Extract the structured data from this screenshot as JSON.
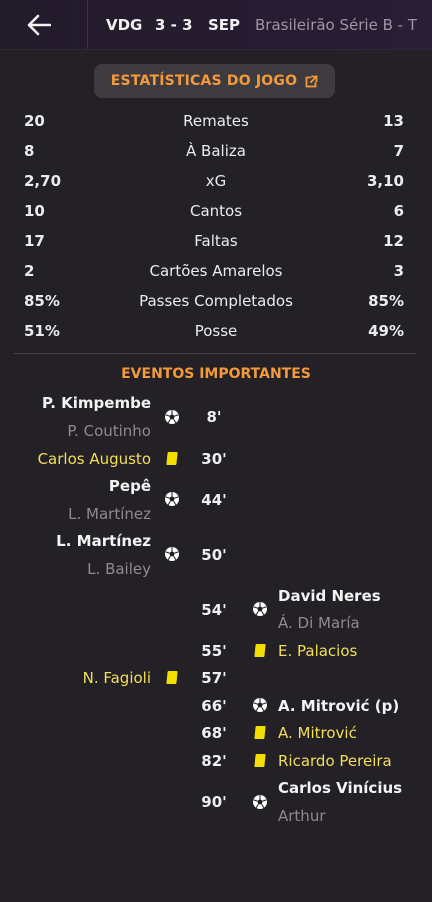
{
  "header": {
    "home_team": "VDG",
    "score": "3 - 3",
    "away_team": "SEP",
    "competition": "Brasileirão Série B  -  T"
  },
  "stats_title": "ESTATÍSTICAS DO JOGO",
  "stats": [
    {
      "name": "Remates",
      "home": "20",
      "away": "13"
    },
    {
      "name": "À Baliza",
      "home": "8",
      "away": "7"
    },
    {
      "name": "xG",
      "home": "2,70",
      "away": "3,10"
    },
    {
      "name": "Cantos",
      "home": "10",
      "away": "6"
    },
    {
      "name": "Faltas",
      "home": "17",
      "away": "12"
    },
    {
      "name": "Cartões Amarelos",
      "home": "2",
      "away": "3"
    },
    {
      "name": "Passes Completados",
      "home": "85%",
      "away": "85%"
    },
    {
      "name": "Posse",
      "home": "51%",
      "away": "49%"
    }
  ],
  "events_title": "EVENTOS IMPORTANTES",
  "events": [
    {
      "minute": "8'",
      "side": "home",
      "type": "goal",
      "player": "P. Kimpembe",
      "assist": "P. Coutinho"
    },
    {
      "minute": "30'",
      "side": "home",
      "type": "yellow",
      "player": "Carlos Augusto"
    },
    {
      "minute": "44'",
      "side": "home",
      "type": "goal",
      "player": "Pepê",
      "assist": "L. Martínez"
    },
    {
      "minute": "50'",
      "side": "home",
      "type": "goal",
      "player": "L. Martínez",
      "assist": "L. Bailey"
    },
    {
      "minute": "54'",
      "side": "away",
      "type": "goal",
      "player": "David Neres",
      "assist": "Á. Di María"
    },
    {
      "minute": "55'",
      "side": "away",
      "type": "yellow",
      "player": "E. Palacios"
    },
    {
      "minute": "57'",
      "side": "home",
      "type": "yellow",
      "player": "N. Fagioli"
    },
    {
      "minute": "66'",
      "side": "away",
      "type": "goal",
      "player": "A. Mitrović (p)"
    },
    {
      "minute": "68'",
      "side": "away",
      "type": "yellow",
      "player": "A. Mitrović"
    },
    {
      "minute": "82'",
      "side": "away",
      "type": "yellow",
      "player": "Ricardo Pereira"
    },
    {
      "minute": "90'",
      "side": "away",
      "type": "goal",
      "player": "Carlos Vinícius",
      "assist": "Arthur"
    }
  ],
  "colors": {
    "accent": "#f39a3a",
    "yellow_card": "#f2df00",
    "background": "#232026"
  },
  "icons": {
    "back": "arrow-left-icon",
    "popout": "external-link-icon",
    "goal": "football-icon",
    "card": "yellow-card-icon"
  }
}
